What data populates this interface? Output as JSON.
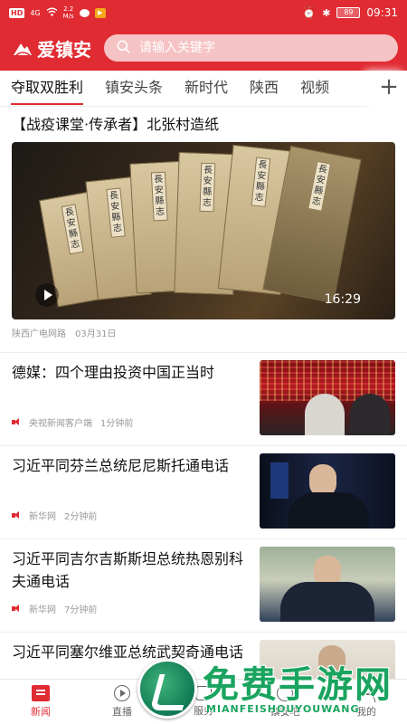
{
  "status_bar": {
    "network_badge": "HD",
    "signal": "4G",
    "speed": "2.2",
    "speed_unit": "M/s",
    "battery": "89",
    "time": "09:31"
  },
  "header": {
    "app_name": "爱镇安",
    "search_placeholder": "请输入关键字"
  },
  "tabs": [
    {
      "label": "夺取双胜利"
    },
    {
      "label": "镇安头条"
    },
    {
      "label": "新时代"
    },
    {
      "label": "陕西"
    },
    {
      "label": "视频"
    }
  ],
  "tab_add_label": "+",
  "feature": {
    "title": "【战疫课堂·传承者】北张村造纸",
    "duration": "16:29",
    "source": "陕西广电网路",
    "date": "03月31日",
    "book_label": "長安縣志"
  },
  "news": [
    {
      "title": "德媒：四个理由投资中国正当时",
      "source": "央视新闻客户端",
      "time": "1分钟前"
    },
    {
      "title": "习近平同芬兰总统尼尼斯托通电话",
      "source": "新华网",
      "time": "2分钟前"
    },
    {
      "title": "习近平同吉尔吉斯斯坦总统热恩别科夫通电话",
      "source": "新华网",
      "time": "7分钟前"
    },
    {
      "title": "习近平同塞尔维亚总统武契奇通电话"
    }
  ],
  "bottom_nav": [
    {
      "label": "新闻"
    },
    {
      "label": "直播"
    },
    {
      "label": "服务"
    },
    {
      "label": "镇安吧"
    },
    {
      "label": "我的"
    }
  ],
  "watermark": {
    "title": "免费手游网",
    "subtitle": "MIANFEISHOUYOUWANG"
  },
  "colors": {
    "brand_red": "#e02b33",
    "watermark_green": "#19a45f"
  }
}
